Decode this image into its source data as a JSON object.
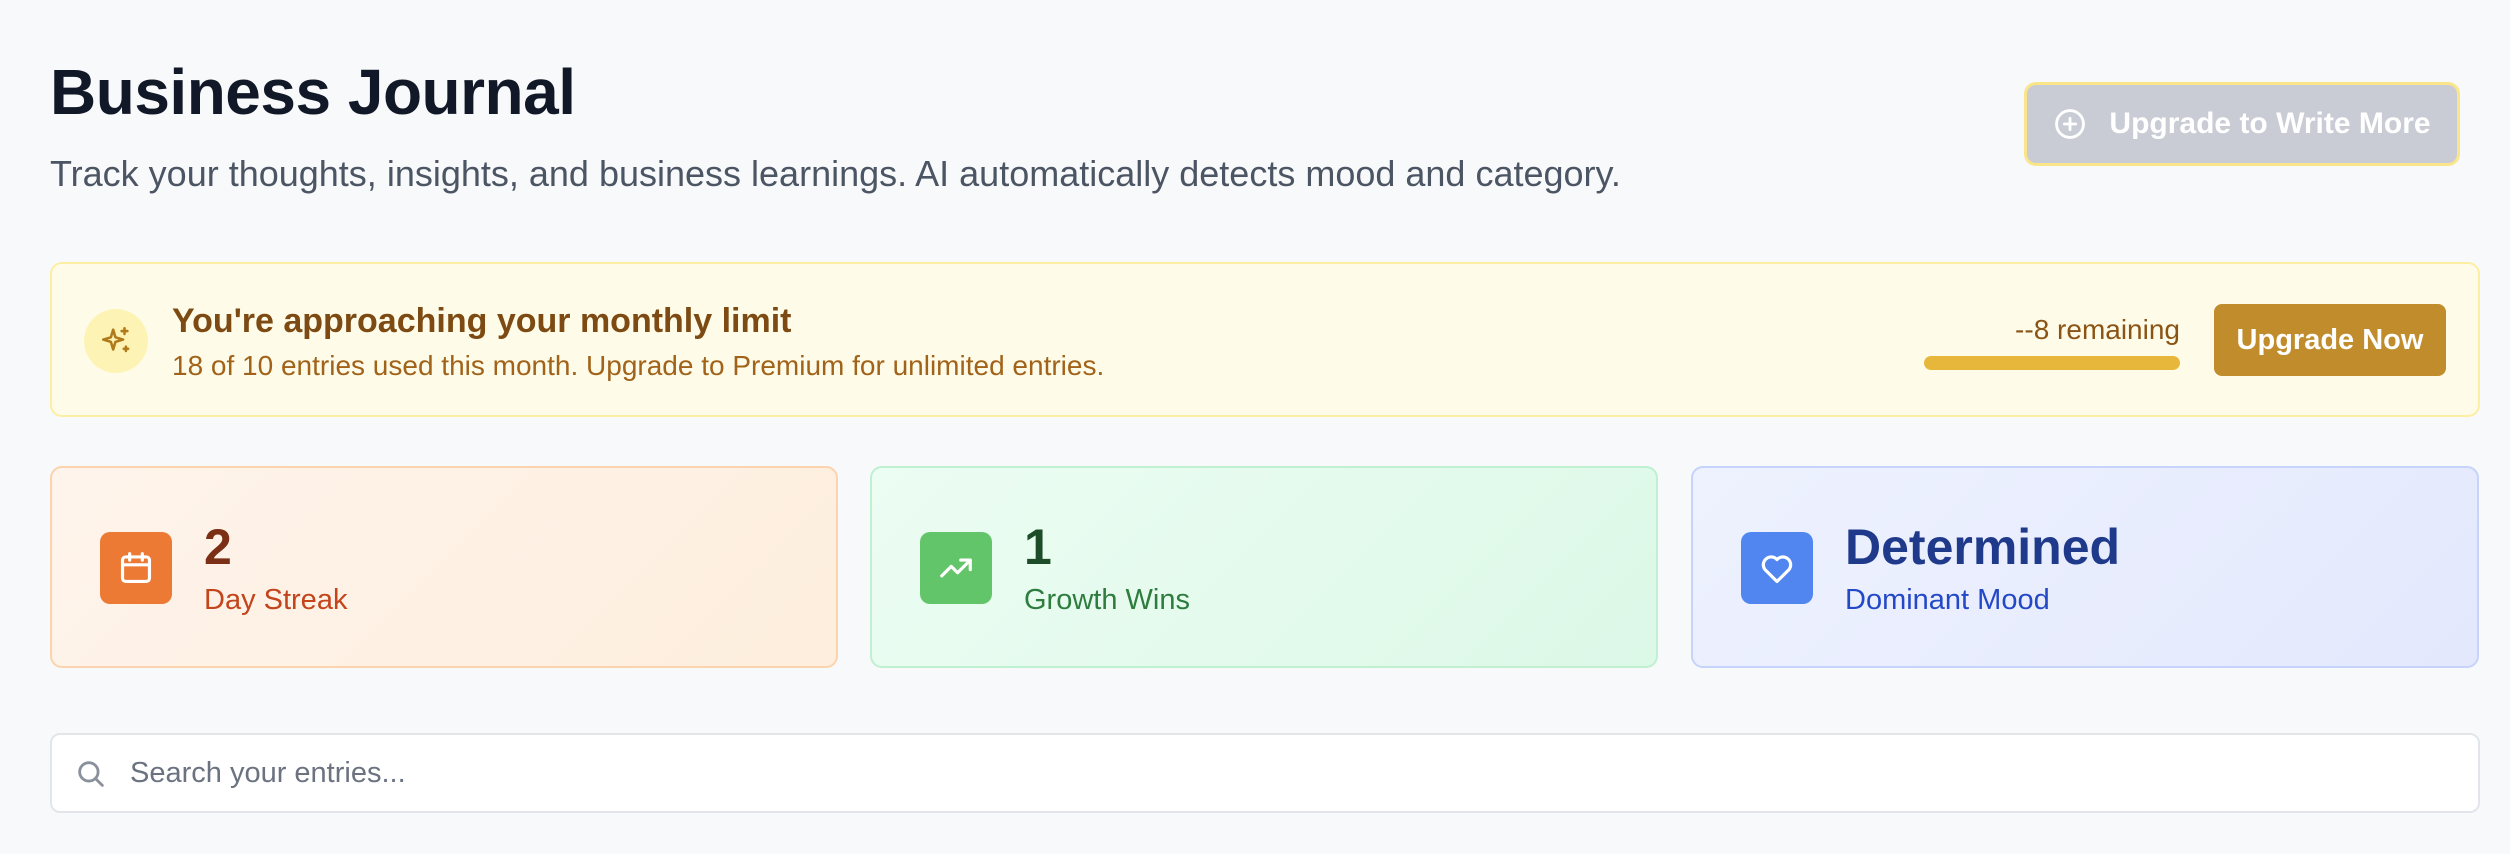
{
  "header": {
    "title": "Business Journal",
    "subtitle": "Track your thoughts, insights, and business learnings. AI automatically detects mood and category.",
    "upgrade_button": "Upgrade to Write More",
    "upgrade_icon": "plus-circle-icon"
  },
  "limit_banner": {
    "icon": "sparkles-icon",
    "title": "You're approaching your monthly limit",
    "description": "18 of 10 entries used this month. Upgrade to Premium for unlimited entries.",
    "remaining_text": "--8 remaining",
    "usage_fraction": 1.0,
    "upgrade_button": "Upgrade Now",
    "colors": {
      "background": "#fefce8",
      "bar": "#e6b73a",
      "button": "#c08c2c"
    }
  },
  "stats": [
    {
      "value": "2",
      "label": "Day Streak",
      "icon": "calendar-icon",
      "accent": "#ec7a35"
    },
    {
      "value": "1",
      "label": "Growth Wins",
      "icon": "trending-up-icon",
      "accent": "#63c56a"
    },
    {
      "value": "Determined",
      "label": "Dominant Mood",
      "icon": "heart-icon",
      "accent": "#5186f0"
    }
  ],
  "search": {
    "placeholder": "Search your entries...",
    "value": "",
    "icon": "search-icon"
  }
}
